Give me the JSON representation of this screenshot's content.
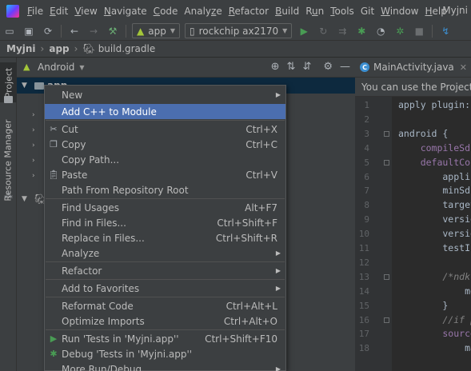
{
  "window": {
    "title": "Myjni"
  },
  "menubar": {
    "items": [
      {
        "pre": "",
        "u": "F",
        "post": "ile"
      },
      {
        "pre": "",
        "u": "E",
        "post": "dit"
      },
      {
        "pre": "",
        "u": "V",
        "post": "iew"
      },
      {
        "pre": "",
        "u": "N",
        "post": "avigate"
      },
      {
        "pre": "",
        "u": "C",
        "post": "ode"
      },
      {
        "pre": "Analy",
        "u": "z",
        "post": "e"
      },
      {
        "pre": "",
        "u": "R",
        "post": "efactor"
      },
      {
        "pre": "",
        "u": "B",
        "post": "uild"
      },
      {
        "pre": "R",
        "u": "u",
        "post": "n"
      },
      {
        "pre": "",
        "u": "T",
        "post": "ools"
      },
      {
        "pre": "Git",
        "u": "",
        "post": ""
      },
      {
        "pre": "",
        "u": "W",
        "post": "indow"
      },
      {
        "pre": "",
        "u": "H",
        "post": "elp"
      }
    ]
  },
  "toolbar": {
    "module_combo": "app",
    "device_combo": "rockchip ax2170"
  },
  "breadcrumb": {
    "project": "Myjni",
    "module": "app",
    "file": "build.gradle"
  },
  "leftstrip": {
    "project_tab": "Project",
    "resource_tab": "Resource Manager"
  },
  "project_panel": {
    "view_mode": "Android",
    "root_item": "app"
  },
  "editor": {
    "tabs": [
      {
        "label": "MainActivity.java"
      }
    ],
    "notice": "You can use the Project Str",
    "line_numbers": [
      "1",
      "2",
      "3",
      "4",
      "5",
      "6",
      "7",
      "8",
      "9",
      "10",
      "11",
      "12",
      "13",
      "14",
      "15",
      "16",
      "17",
      "18"
    ],
    "lines": [
      {
        "t": "apply plugin: '"
      },
      {
        "t": ""
      },
      {
        "t": "android {"
      },
      {
        "t": "    compileSdkV"
      },
      {
        "t": "    defaultConf"
      },
      {
        "t": "        applica"
      },
      {
        "t": "        minSdkV"
      },
      {
        "t": "        targetS"
      },
      {
        "t": "        version"
      },
      {
        "t": "        version"
      },
      {
        "t": "        testIns"
      },
      {
        "t": ""
      },
      {
        "t": "        /*ndk {"
      },
      {
        "t": "            mod"
      },
      {
        "t": "        }"
      },
      {
        "t": "        //if pu"
      },
      {
        "t": "        sourceS"
      },
      {
        "t": "            mai"
      }
    ]
  },
  "context_menu": {
    "items": [
      {
        "type": "item",
        "label": "New",
        "submenu": true
      },
      {
        "type": "item",
        "label": "Add C++ to Module",
        "selected": true
      },
      {
        "type": "sep"
      },
      {
        "type": "item",
        "label": "Cut",
        "shortcut": "Ctrl+X",
        "icon": "cut-icon"
      },
      {
        "type": "item",
        "label": "Copy",
        "shortcut": "Ctrl+C",
        "icon": "copy-icon"
      },
      {
        "type": "item",
        "label": "Copy Path...",
        "shortcut": ""
      },
      {
        "type": "item",
        "label": "Paste",
        "shortcut": "Ctrl+V",
        "icon": "paste-icon"
      },
      {
        "type": "item",
        "label": "Path From Repository Root",
        "shortcut": ""
      },
      {
        "type": "sep"
      },
      {
        "type": "item",
        "label": "Find Usages",
        "shortcut": "Alt+F7"
      },
      {
        "type": "item",
        "label": "Find in Files...",
        "shortcut": "Ctrl+Shift+F"
      },
      {
        "type": "item",
        "label": "Replace in Files...",
        "shortcut": "Ctrl+Shift+R"
      },
      {
        "type": "item",
        "label": "Analyze",
        "submenu": true
      },
      {
        "type": "sep"
      },
      {
        "type": "item",
        "label": "Refactor",
        "submenu": true
      },
      {
        "type": "sep"
      },
      {
        "type": "item",
        "label": "Add to Favorites",
        "submenu": true
      },
      {
        "type": "sep"
      },
      {
        "type": "item",
        "label": "Reformat Code",
        "shortcut": "Ctrl+Alt+L"
      },
      {
        "type": "item",
        "label": "Optimize Imports",
        "shortcut": "Ctrl+Alt+O"
      },
      {
        "type": "sep"
      },
      {
        "type": "item",
        "label": "Run 'Tests in 'Myjni.app''",
        "shortcut": "Ctrl+Shift+F10",
        "icon": "run-icon"
      },
      {
        "type": "item",
        "label": "Debug 'Tests in 'Myjni.app''",
        "shortcut": "",
        "icon": "debug-icon"
      },
      {
        "type": "item",
        "label": "More Run/Debug",
        "submenu": true
      }
    ]
  },
  "colors": {
    "accent": "#4b6eaf",
    "panel": "#3c3f41",
    "editor": "#2b2b2b",
    "run": "#499c54"
  }
}
